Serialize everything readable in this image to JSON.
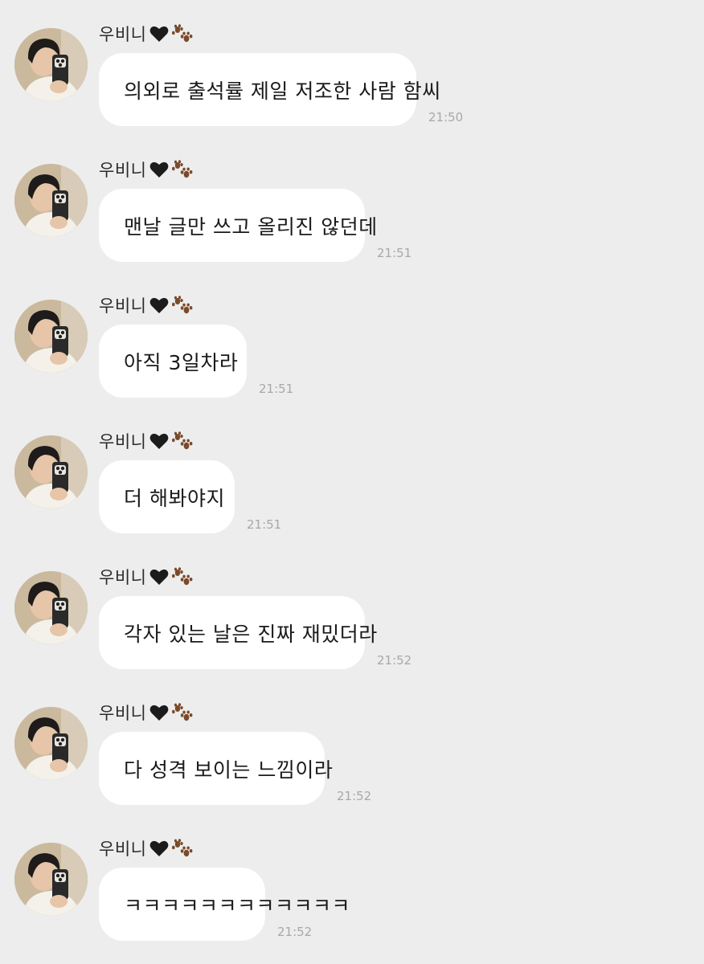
{
  "sender": {
    "name": "우비니",
    "emoji_heart": "black-heart-icon",
    "emoji_paw": "paw-prints-icon"
  },
  "colors": {
    "background": "#ededed",
    "bubble": "#ffffff",
    "text": "#1a1a1a",
    "timestamp": "#a8a8a8"
  },
  "messages": [
    {
      "text": "의외로 출석률 제일 저조한 사람 함씨",
      "time": "21:50"
    },
    {
      "text": "맨날 글만 쓰고 올리진 않던데",
      "time": "21:51"
    },
    {
      "text": "아직 3일차라",
      "time": "21:51"
    },
    {
      "text": "더 해봐야지",
      "time": "21:51"
    },
    {
      "text": "각자 있는 날은 진짜 재밌더라",
      "time": "21:52"
    },
    {
      "text": "다 성격 보이는 느낌이라",
      "time": "21:52"
    },
    {
      "text": "ㅋㅋㅋㅋㅋㅋㅋㅋㅋㅋㅋㅋ",
      "time": "21:52"
    }
  ]
}
